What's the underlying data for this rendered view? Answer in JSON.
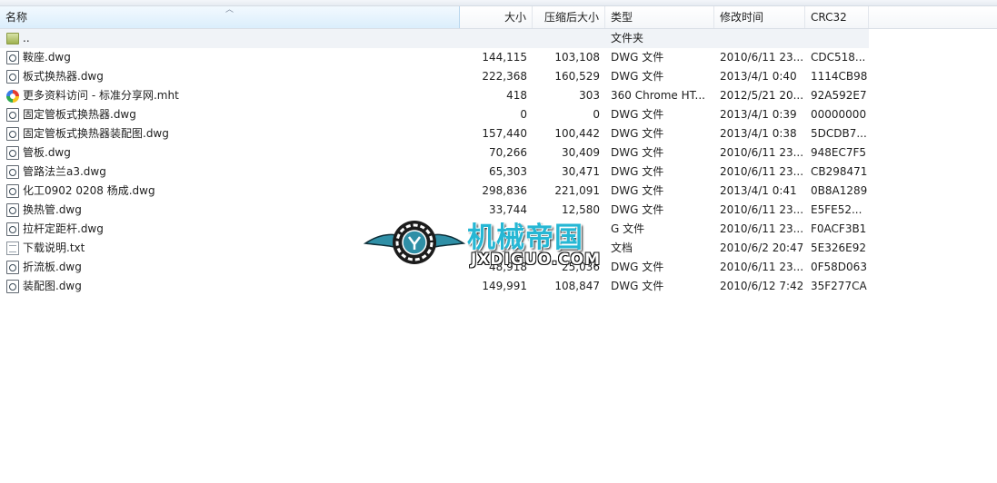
{
  "columns": {
    "name": "名称",
    "size": "大小",
    "compressed": "压缩后大小",
    "type": "类型",
    "modified": "修改时间",
    "crc": "CRC32"
  },
  "parent_row": {
    "name": "..",
    "type": "文件夹",
    "icon": "folder-icon"
  },
  "files": [
    {
      "name": "鞍座.dwg",
      "size": "144,115",
      "compressed": "103,108",
      "type": "DWG 文件",
      "modified": "2010/6/11 23...",
      "crc": "CDC518...",
      "icon": "dwg-file-icon"
    },
    {
      "name": "板式换热器.dwg",
      "size": "222,368",
      "compressed": "160,529",
      "type": "DWG 文件",
      "modified": "2013/4/1 0:40",
      "crc": "1114CB98",
      "icon": "dwg-file-icon"
    },
    {
      "name": "更多资料访问 - 标准分享网.mht",
      "size": "418",
      "compressed": "303",
      "type": "360 Chrome HT...",
      "modified": "2012/5/21 20...",
      "crc": "92A592E7",
      "icon": "mht-file-icon"
    },
    {
      "name": "固定管板式换热器.dwg",
      "size": "0",
      "compressed": "0",
      "type": "DWG 文件",
      "modified": "2013/4/1 0:39",
      "crc": "00000000",
      "icon": "dwg-file-icon"
    },
    {
      "name": "固定管板式换热器装配图.dwg",
      "size": "157,440",
      "compressed": "100,442",
      "type": "DWG 文件",
      "modified": "2013/4/1 0:38",
      "crc": "5DCDB7...",
      "icon": "dwg-file-icon"
    },
    {
      "name": "管板.dwg",
      "size": "70,266",
      "compressed": "30,409",
      "type": "DWG 文件",
      "modified": "2010/6/11 23...",
      "crc": "948EC7F5",
      "icon": "dwg-file-icon"
    },
    {
      "name": "管路法兰a3.dwg",
      "size": "65,303",
      "compressed": "30,471",
      "type": "DWG 文件",
      "modified": "2010/6/11 23...",
      "crc": "CB298471",
      "icon": "dwg-file-icon"
    },
    {
      "name": "化工0902 0208 杨成.dwg",
      "size": "298,836",
      "compressed": "221,091",
      "type": "DWG 文件",
      "modified": "2013/4/1 0:41",
      "crc": "0B8A1289",
      "icon": "dwg-file-icon"
    },
    {
      "name": "换热管.dwg",
      "size": "33,744",
      "compressed": "12,580",
      "type": "DWG 文件",
      "modified": "2010/6/11 23...",
      "crc": "E5FE52...",
      "icon": "dwg-file-icon"
    },
    {
      "name": "拉杆定距杆.dwg",
      "size": "",
      "compressed": "",
      "type": "G 文件",
      "modified": "2010/6/11 23...",
      "crc": "F0ACF3B1",
      "icon": "dwg-file-icon"
    },
    {
      "name": "下载说明.txt",
      "size": "",
      "compressed": "",
      "type": "文档",
      "modified": "2010/6/2 20:47",
      "crc": "5E326E92",
      "icon": "txt-file-icon"
    },
    {
      "name": "折流板.dwg",
      "size": "48,918",
      "compressed": "25,036",
      "type": "DWG 文件",
      "modified": "2010/6/11 23...",
      "crc": "0F58D063",
      "icon": "dwg-file-icon"
    },
    {
      "name": "装配图.dwg",
      "size": "149,991",
      "compressed": "108,847",
      "type": "DWG 文件",
      "modified": "2010/6/12 7:42",
      "crc": "35F277CA",
      "icon": "dwg-file-icon"
    }
  ],
  "watermark": {
    "title": "机械帝国",
    "subtitle": "JXDIGUO.COM",
    "accent": "#26b7d4",
    "icon": "winged-gear-logo-icon"
  },
  "colors": {
    "header_active": "#dbeefc",
    "parent_row_bg": "#f0f3f7",
    "text": "#1e1e1e"
  }
}
